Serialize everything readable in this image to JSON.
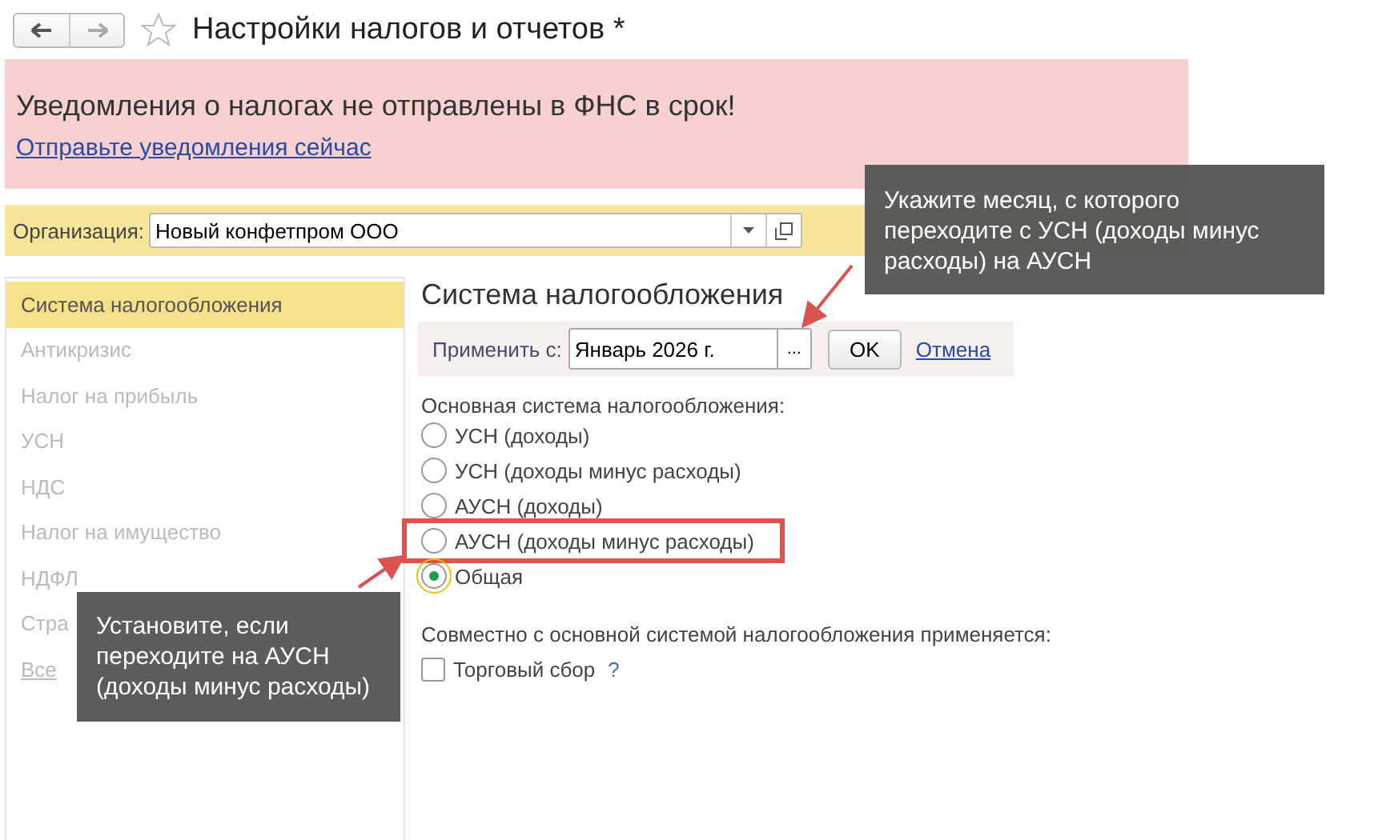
{
  "window": {
    "title": "Настройки налогов и отчетов *",
    "favorite": false
  },
  "alert": {
    "message": "Уведомления о налогах не отправлены в ФНС в срок!",
    "link": "Отправьте уведомления сейчас"
  },
  "organization": {
    "label": "Организация:",
    "value": "Новый конфетпром ООО"
  },
  "sidebar": {
    "items": [
      {
        "label": "Система налогообложения",
        "selected": true,
        "kind": "item"
      },
      {
        "label": "Антикризис",
        "selected": false,
        "kind": "item"
      },
      {
        "label": "Налог на прибыль",
        "selected": false,
        "kind": "item"
      },
      {
        "label": "УСН",
        "selected": false,
        "kind": "item"
      },
      {
        "label": "НДС",
        "selected": false,
        "kind": "item"
      },
      {
        "label": "Налог на имущество",
        "selected": false,
        "kind": "item"
      },
      {
        "label": "НДФЛ",
        "selected": false,
        "kind": "item"
      },
      {
        "label": "Стра",
        "selected": false,
        "kind": "item"
      },
      {
        "label": "Все",
        "selected": false,
        "kind": "link"
      }
    ]
  },
  "section": {
    "title": "Система налогообложения",
    "apply": {
      "label": "Применить с:",
      "value": "Январь 2026 г.",
      "picker": "...",
      "ok": "OK",
      "cancel": "Отмена"
    },
    "main_label": "Основная система налогообложения:",
    "options": [
      {
        "label": "УСН (доходы)",
        "selected": false,
        "highlighted": false
      },
      {
        "label": "УСН (доходы минус расходы)",
        "selected": false,
        "highlighted": false
      },
      {
        "label": "АУСН (доходы)",
        "selected": false,
        "highlighted": false
      },
      {
        "label": "АУСН (доходы минус расходы)",
        "selected": false,
        "highlighted": true
      },
      {
        "label": "Общая",
        "selected": true,
        "highlighted": false
      }
    ],
    "extra_label": "Совместно с основной системой налогообложения применяется:",
    "extras": [
      {
        "label": "Торговый сбор",
        "checked": false,
        "help": "?"
      }
    ]
  },
  "callouts": [
    {
      "text": "Укажите месяц, с которого переходите с УСН (доходы минус расходы) на АУСН",
      "kind": "top"
    },
    {
      "text": "Установите, если переходите на АУСН (доходы минус расходы)",
      "kind": "bottom"
    }
  ]
}
